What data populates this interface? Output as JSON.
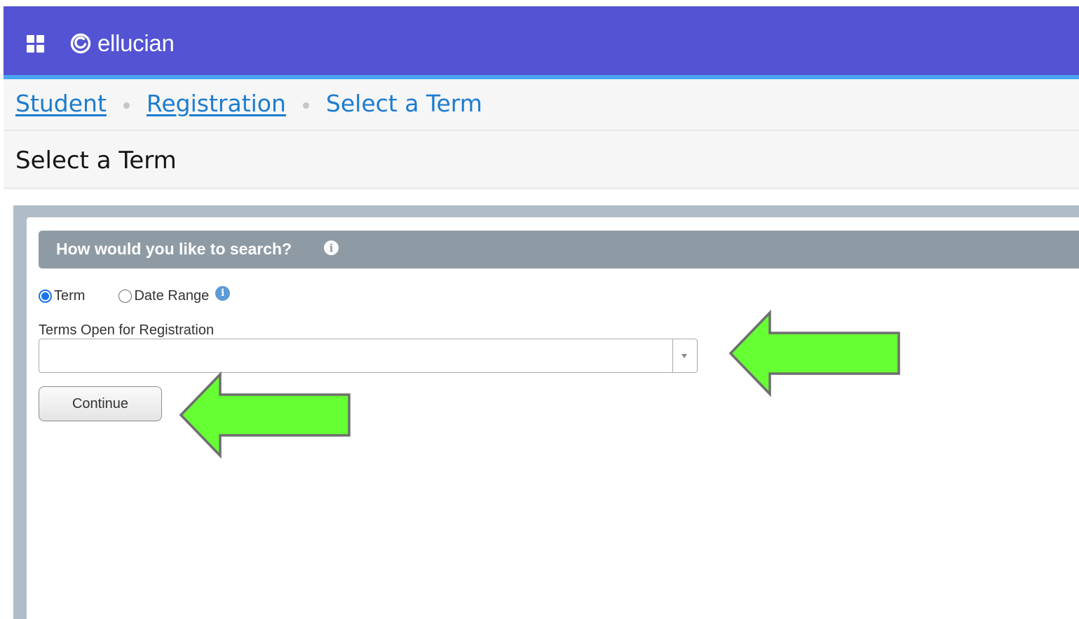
{
  "header": {
    "brand": "ellucian",
    "apps_icon": "grid-menu-icon",
    "logo_icon": "ellucian-logo-icon",
    "colors": {
      "bar": "#5353d3",
      "accent_line": "#4aa3f0"
    }
  },
  "breadcrumb": {
    "items": [
      {
        "label": "Student",
        "link": true
      },
      {
        "label": "Registration",
        "link": true
      },
      {
        "label": "Select a Term",
        "link": false
      }
    ]
  },
  "page": {
    "title": "Select a Term"
  },
  "search": {
    "title": "How would you like to search?",
    "info_icon": "info-circle-icon",
    "options": [
      {
        "label": "Term",
        "selected": true
      },
      {
        "label": "Date Range",
        "selected": false
      }
    ],
    "date_range_info_icon": "info-circle-icon"
  },
  "terms_field": {
    "label": "Terms Open for Registration",
    "value": "",
    "arrow_icon": "dropdown-caret-icon"
  },
  "continue_button": {
    "label": "Continue"
  },
  "annotations": {
    "arrow_color": "#66ff33",
    "arrow_icon": "left-arrow-icon"
  }
}
